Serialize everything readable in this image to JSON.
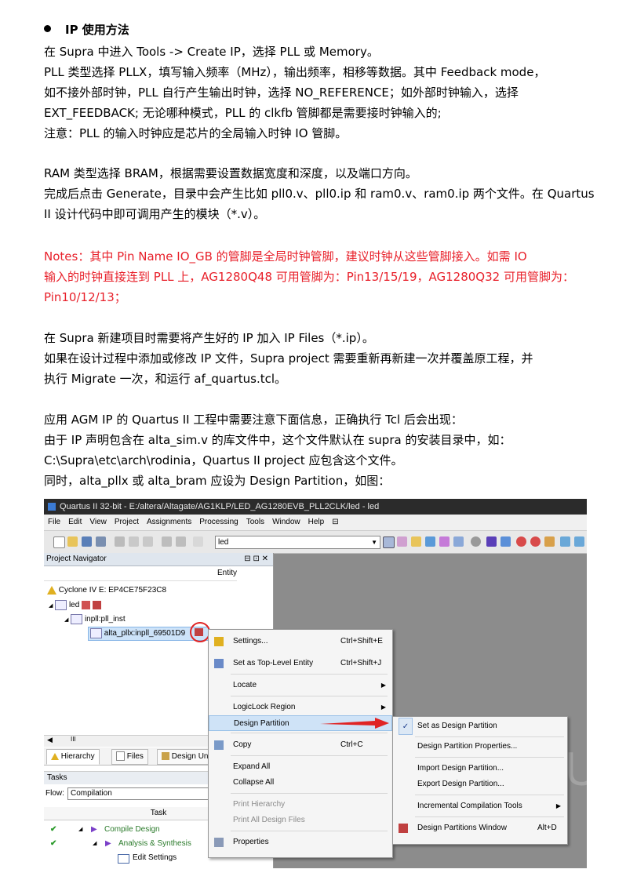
{
  "doc": {
    "heading": "IP 使用方法",
    "lines": [
      "在 Supra 中进入 Tools -> Create IP，选择 PLL 或 Memory。",
      "PLL 类型选择 PLLX，填写输入频率（MHz），输出频率，相移等数据。其中 Feedback mode，",
      "如不接外部时钟，PLL 自行产生输出时钟，选择 NO_REFERENCE；如外部时钟输入，选择",
      "EXT_FEEDBACK; 无论哪种模式，PLL 的 clkfb 管脚都是需要接时钟输入的;",
      "注意：PLL 的输入时钟应是芯片的全局输入时钟 IO 管脚。",
      "RAM 类型选择 BRAM，根据需要设置数据宽度和深度，以及端口方向。",
      "完成后点击 Generate，目录中会产生比如 pll0.v、pll0.ip 和 ram0.v、ram0.ip 两个文件。在 Quartus",
      "II 设计代码中即可调用产生的模块（*.v）。"
    ],
    "notes": [
      "Notes：其中 Pin Name IO_GB 的管脚是全局时钟管脚，建议时钟从这些管脚接入。如需 IO",
      "输入的时钟直接连到 PLL 上，AG1280Q48 可用管脚为：Pin13/15/19，AG1280Q32 可用管脚为：",
      "Pin10/12/13；"
    ],
    "lines2": [
      "在 Supra 新建项目时需要将产生好的 IP 加入 IP Files（*.ip）。",
      "如果在设计过程中添加或修改 IP 文件，Supra project 需要重新再新建一次并覆盖原工程，并",
      "执行 Migrate 一次，和运行 af_quartus.tcl。",
      "应用 AGM IP 的 Quartus II 工程中需要注意下面信息，正确执行 Tcl 后会出现：",
      "由于 IP 声明包含在 alta_sim.v 的库文件中，这个文件默认在 supra 的安装目录中，如：",
      "C:\\Supra\\etc\\arch\\rodinia，Quartus II project 应包含这个文件。",
      "同时，alta_pllx 或 alta_bram 应设为 Design Partition，如图："
    ]
  },
  "screenshot": {
    "title": "Quartus II 32-bit - E:/altera/Altagate/AG1KLP/LED_AG1280EVB_PLL2CLK/led - led",
    "menu": [
      "File",
      "Edit",
      "View",
      "Project",
      "Assignments",
      "Processing",
      "Tools",
      "Window",
      "Help"
    ],
    "combo_value": "led",
    "navigator_title": "Project Navigator",
    "navigator_controls": "⊟ ⊡ ✕",
    "entity_header": "Entity",
    "device": "Cyclone IV E: EP4CE75F23C8",
    "tree_led": "led",
    "tree_pll": "inpll:pll_inst",
    "tree_alta": "alta_pllx:inpll_69501D9",
    "scroll_mark": "III",
    "tabs": [
      "Hierarchy",
      "Files",
      "Design Un"
    ],
    "tasks_label": "Tasks",
    "flow_label": "Flow:",
    "flow_value": "Compilation",
    "task_col": "Task",
    "tasks": [
      "Compile Design",
      "Analysis & Synthesis",
      "Edit Settings"
    ],
    "context_menu": [
      {
        "label": "Settings...",
        "shortcut": "Ctrl+Shift+E"
      },
      {
        "label": "Set as Top-Level Entity",
        "shortcut": "Ctrl+Shift+J"
      },
      {
        "label": "Locate",
        "shortcut": ""
      },
      {
        "label": "LogicLock Region",
        "shortcut": ""
      },
      {
        "label": "Design Partition",
        "shortcut": ""
      },
      {
        "label": "Copy",
        "shortcut": "Ctrl+C"
      },
      {
        "label": "Expand All",
        "shortcut": ""
      },
      {
        "label": "Collapse All",
        "shortcut": ""
      },
      {
        "label": "Print Hierarchy",
        "shortcut": ""
      },
      {
        "label": "Print All Design Files",
        "shortcut": ""
      },
      {
        "label": "Properties",
        "shortcut": ""
      }
    ],
    "submenu": [
      {
        "label": "Set as Design Partition",
        "shortcut": ""
      },
      {
        "label": "Design Partition Properties...",
        "shortcut": ""
      },
      {
        "label": "Import Design Partition...",
        "shortcut": ""
      },
      {
        "label": "Export Design Partition...",
        "shortcut": ""
      },
      {
        "label": "Incremental Compilation Tools",
        "shortcut": ""
      },
      {
        "label": "Design Partitions Window",
        "shortcut": "Alt+D"
      }
    ],
    "colors": {
      "note_red": "#e8202a",
      "arrow_red": "#e02424",
      "highlight": "#cfe3f7"
    }
  }
}
